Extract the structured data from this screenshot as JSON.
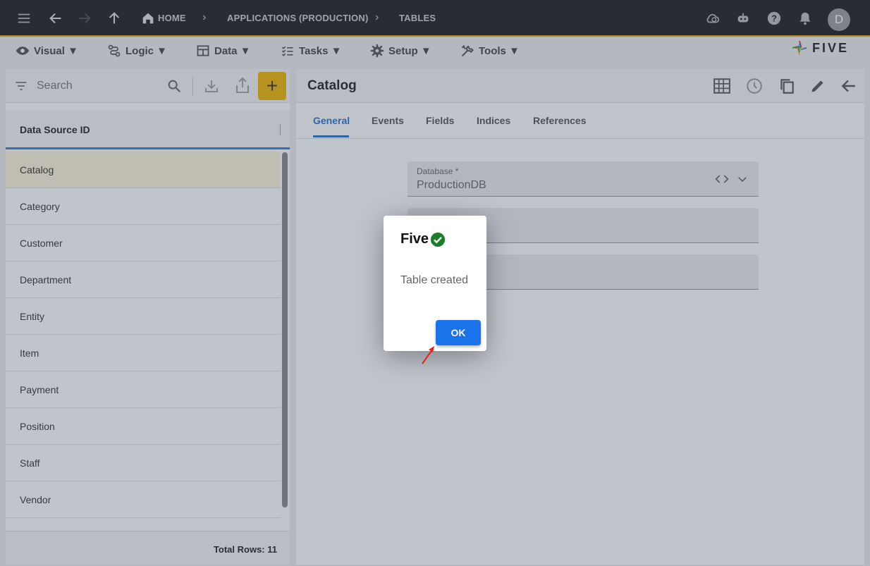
{
  "topbar": {
    "breadcrumbs": [
      "HOME",
      "APPLICATIONS (PRODUCTION)",
      "TABLES"
    ],
    "avatar_initial": "D"
  },
  "menus": [
    {
      "label": "Visual ▼",
      "icon": "eye-icon"
    },
    {
      "label": "Logic ▼",
      "icon": "logic-icon"
    },
    {
      "label": "Data ▼",
      "icon": "table-icon"
    },
    {
      "label": "Tasks ▼",
      "icon": "tasks-icon"
    },
    {
      "label": "Setup ▼",
      "icon": "gear-icon"
    },
    {
      "label": "Tools ▼",
      "icon": "tools-icon"
    }
  ],
  "logo": {
    "text": "FIVE"
  },
  "left_panel": {
    "search_placeholder": "Search",
    "column_header": "Data Source ID",
    "items": [
      "Catalog",
      "Category",
      "Customer",
      "Department",
      "Entity",
      "Item",
      "Payment",
      "Position",
      "Staff",
      "Vendor"
    ],
    "selected": "Catalog",
    "footer": "Total Rows: 11"
  },
  "right_panel": {
    "title": "Catalog",
    "tabs": [
      "General",
      "Events",
      "Fields",
      "Indices",
      "References"
    ],
    "active_tab": "General",
    "fields": [
      {
        "label": "Database *",
        "value": "ProductionDB"
      }
    ]
  },
  "dialog": {
    "title": "Five",
    "message": "Table created",
    "ok_label": "OK"
  },
  "colors": {
    "accent": "#1a73e8",
    "topbar": "#202020",
    "add_button": "#f0b400",
    "success": "#1e7d2c"
  }
}
